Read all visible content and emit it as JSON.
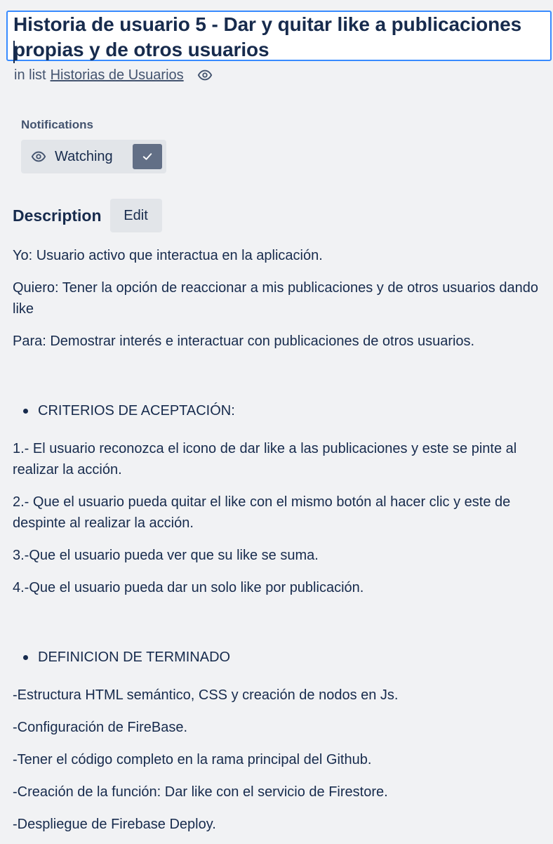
{
  "card": {
    "title": "Historia de usuario 5 - Dar y quitar like a publicaciones propias y de otros usuarios",
    "in_list_prefix": "in list",
    "list_name": "Historias de Usuarios"
  },
  "notifications": {
    "label": "Notifications",
    "watching_label": "Watching"
  },
  "description": {
    "heading": "Description",
    "edit_label": "Edit",
    "paragraphs": [
      "Yo: Usuario activo que interactua en la aplicación.",
      "Quiero: Tener la opción de reaccionar a mis publicaciones y de otros usuarios dando like",
      "Para: Demostrar interés e interactuar con publicaciones de otros usuarios."
    ],
    "criteria_heading": "CRITERIOS DE ACEPTACIÓN:",
    "criteria": [
      "1.- El usuario reconozca el icono de dar like a las publicaciones y este se pinte al realizar la acción.",
      "2.- Que el usuario pueda quitar el like con el mismo botón al hacer clic y este de despinte al realizar la acción.",
      "3.-Que el usuario pueda ver que su like se suma.",
      "4.-Que el usuario pueda dar un solo like por publicación."
    ],
    "definition_heading": "DEFINICION DE TERMINADO",
    "definition": [
      "-Estructura HTML semántico, CSS y creación de nodos en Js.",
      "-Configuración de FireBase.",
      "-Tener el código completo en la rama principal del Github.",
      "-Creación de la función: Dar like con el servicio de Firestore.",
      "-Despliegue de Firebase Deploy."
    ]
  },
  "icons": {
    "watch_indicator": "eye-icon",
    "watching_button": "eye-icon",
    "watching_checked": "check-icon"
  },
  "colors": {
    "background": "#f1f2f4",
    "text": "#172b4d",
    "subtle_text": "#44546f",
    "focus_border": "#388bff",
    "button_bg": "#e2e5e9",
    "check_bg": "#626f86"
  }
}
